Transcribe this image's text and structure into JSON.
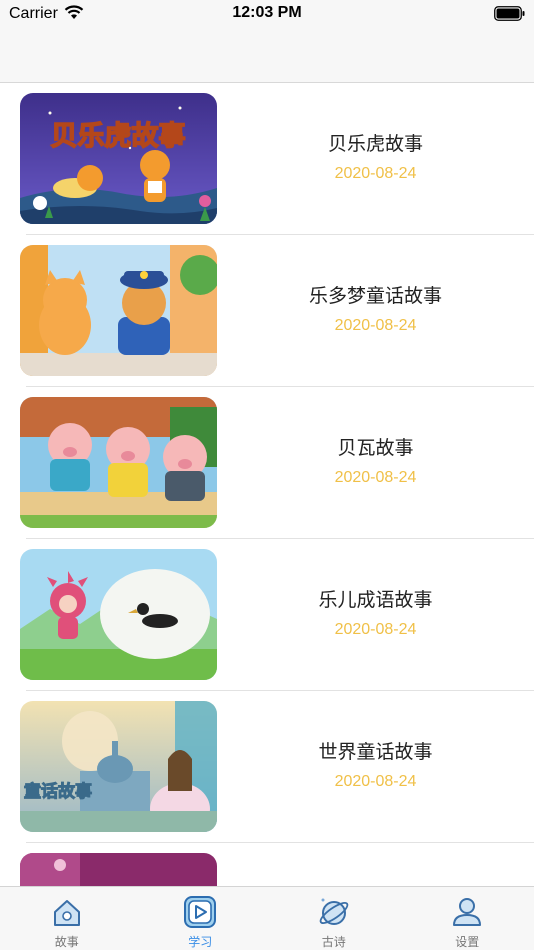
{
  "status_bar": {
    "carrier": "Carrier",
    "time": "12:03 PM"
  },
  "stories": [
    {
      "title": "贝乐虎故事",
      "date": "2020-08-24",
      "thumb_caption": "贝乐虎故事"
    },
    {
      "title": "乐多梦童话故事",
      "date": "2020-08-24"
    },
    {
      "title": "贝瓦故事",
      "date": "2020-08-24"
    },
    {
      "title": "乐儿成语故事",
      "date": "2020-08-24"
    },
    {
      "title": "世界童话故事",
      "date": "2020-08-24",
      "thumb_caption": "童话故事"
    }
  ],
  "tabs": [
    {
      "label": "故事",
      "icon": "house-icon",
      "active": false
    },
    {
      "label": "学习",
      "icon": "play-icon",
      "active": true
    },
    {
      "label": "古诗",
      "icon": "planet-icon",
      "active": false
    },
    {
      "label": "设置",
      "icon": "user-icon",
      "active": false
    }
  ]
}
